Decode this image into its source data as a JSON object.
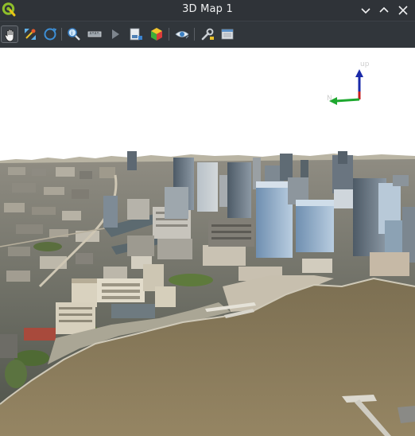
{
  "window": {
    "title": "3D Map 1",
    "controls": [
      "chevron-down-icon",
      "chevron-up-icon",
      "close-icon"
    ]
  },
  "app": {
    "logo_icon": "qgis-logo-icon"
  },
  "toolbar": {
    "tools": [
      {
        "name": "pan-tool",
        "icon": "hand-icon",
        "active": true
      },
      {
        "name": "zoom-full",
        "icon": "zoom-full-icon"
      },
      {
        "name": "camera-rotate",
        "icon": "rotate-icon"
      },
      {
        "name": "identify",
        "icon": "identify-icon"
      },
      {
        "name": "measure",
        "icon": "ruler-icon"
      },
      {
        "name": "animation",
        "icon": "play-icon"
      },
      {
        "name": "export-scene",
        "icon": "export-icon"
      },
      {
        "name": "export-3d",
        "icon": "cube-icon"
      },
      {
        "name": "camera",
        "icon": "eye-icon"
      },
      {
        "name": "options",
        "icon": "wrench-icon"
      },
      {
        "name": "dock",
        "icon": "dock-window-icon"
      }
    ]
  },
  "navigation_axes": {
    "up_label": "up",
    "north_label": "N",
    "colors": {
      "up": "#1a2aa8",
      "north": "#1ea82f",
      "east": "#c31c1c"
    }
  },
  "scene_colors": {
    "sky": "#ffffff",
    "river": "#8a7a57",
    "city": "#6f6e66"
  }
}
